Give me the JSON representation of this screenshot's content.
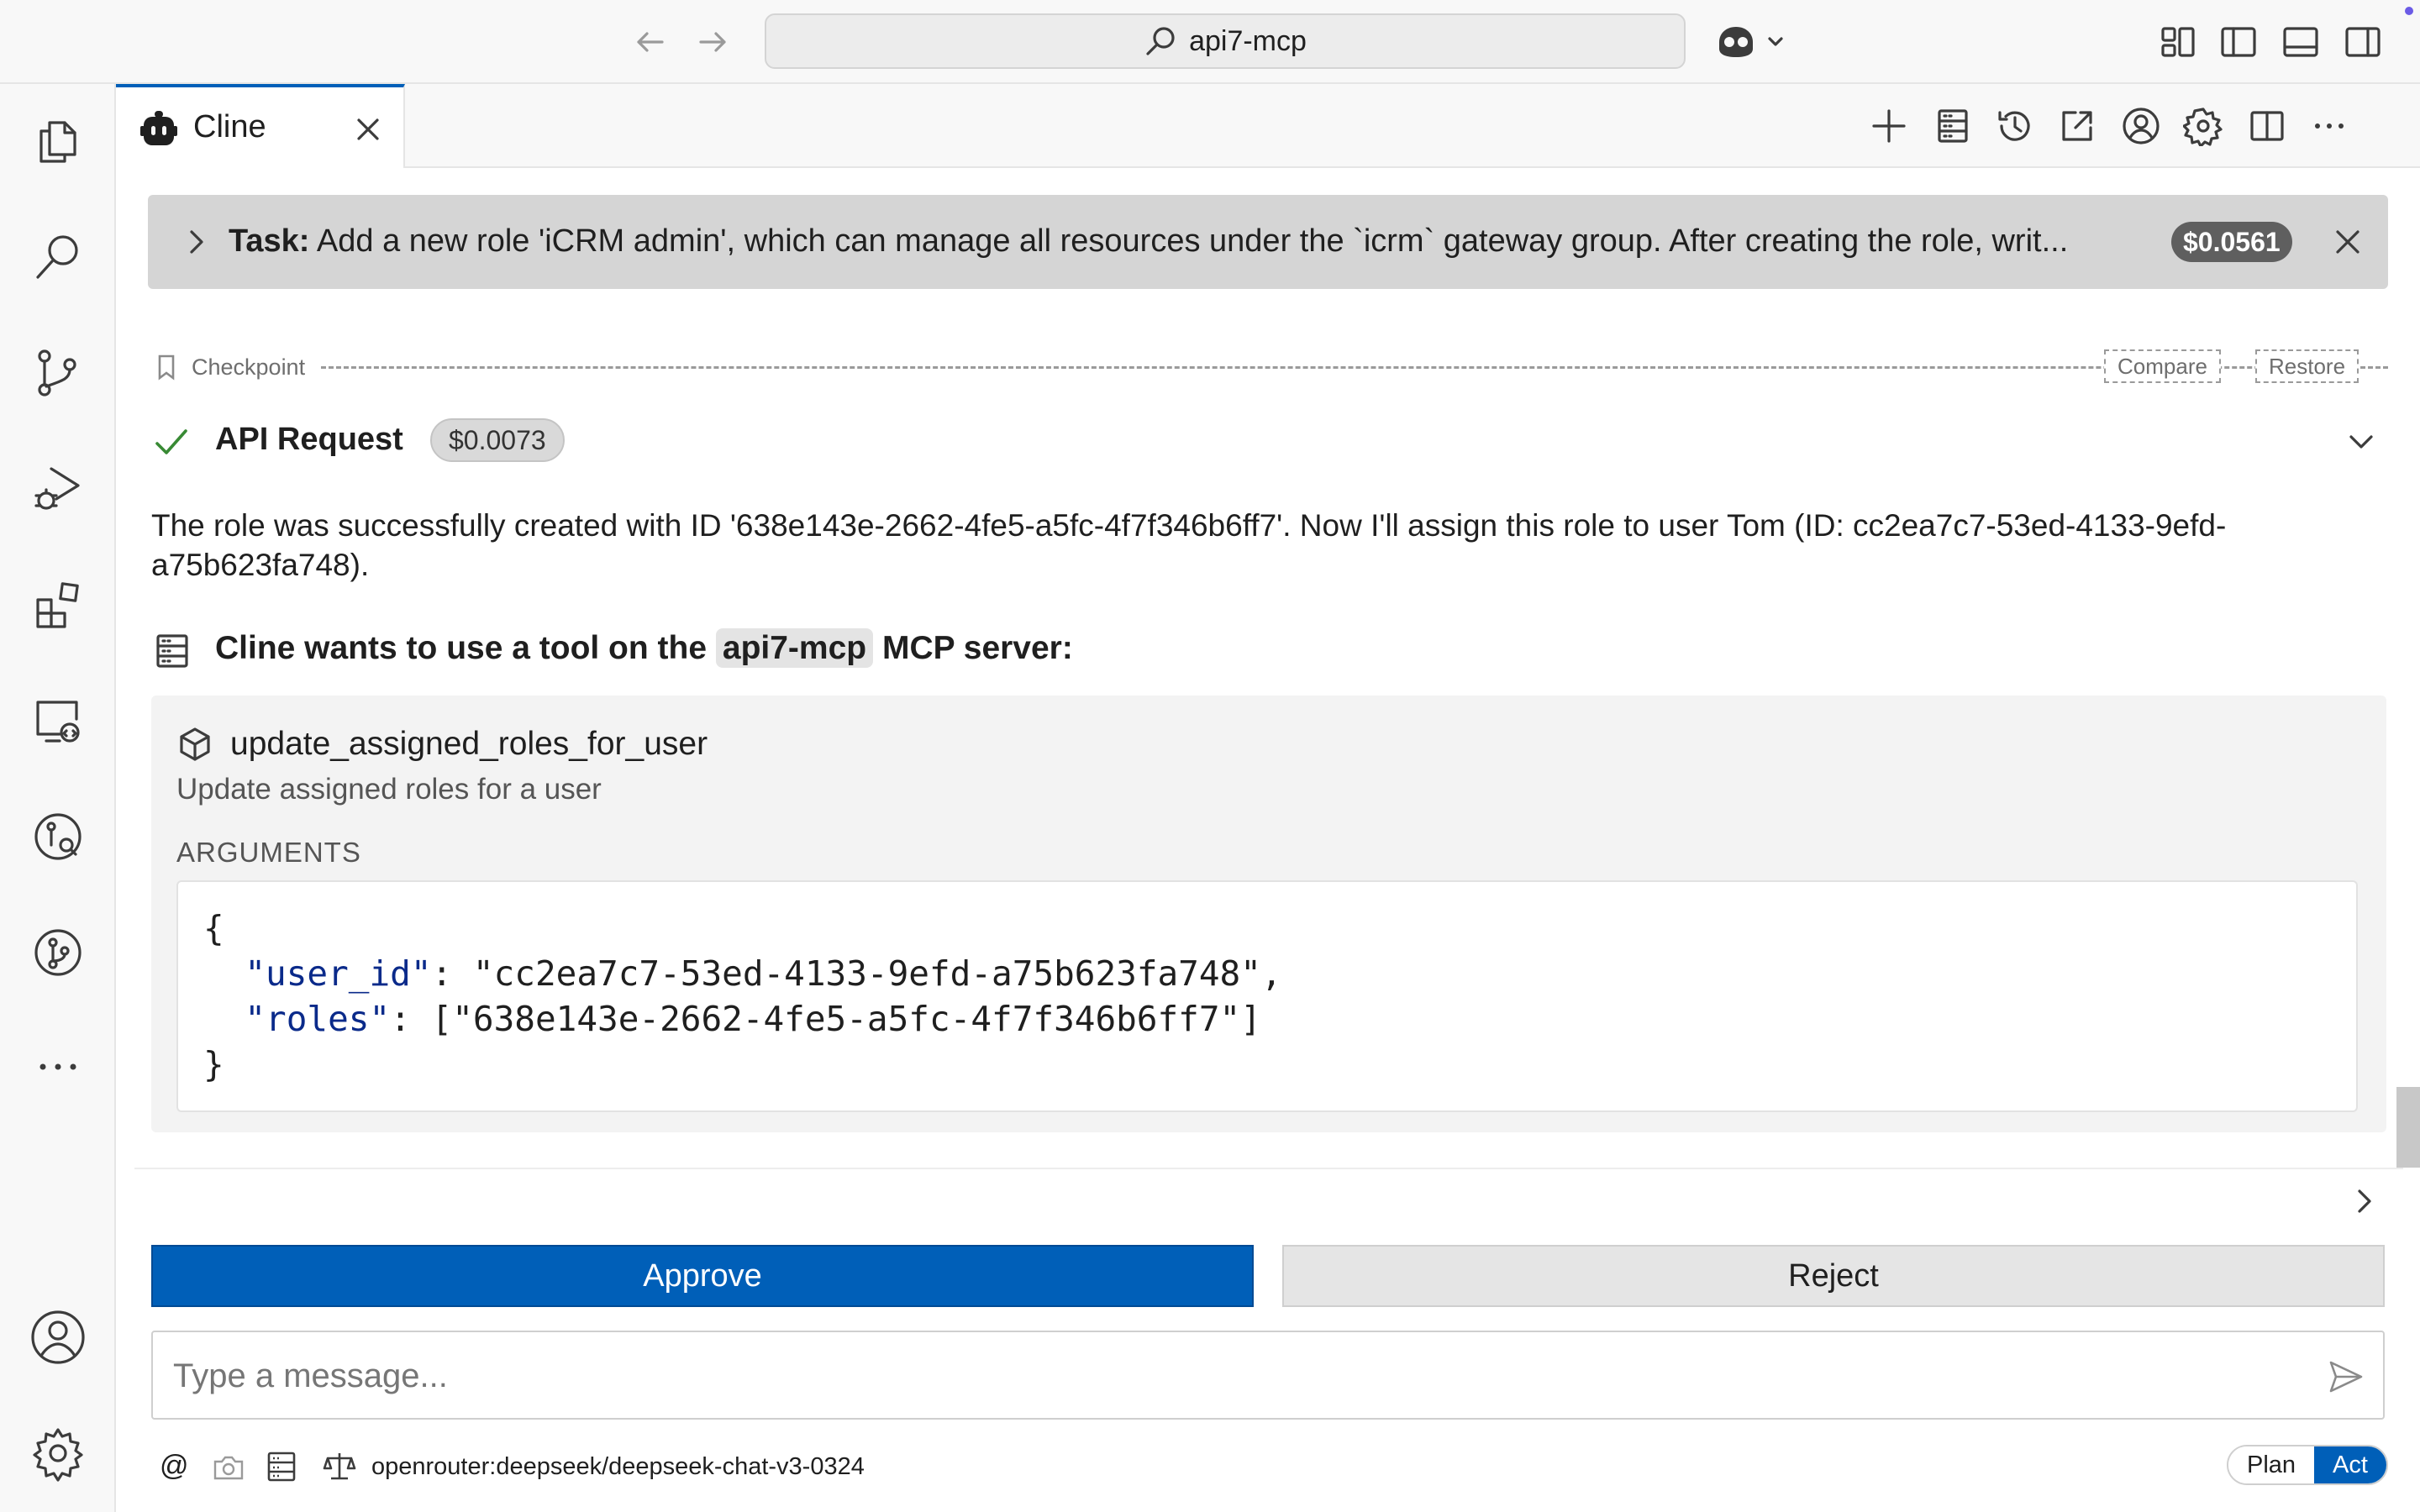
{
  "titlebar": {
    "search_text": "api7-mcp"
  },
  "tab": {
    "label": "Cline"
  },
  "task": {
    "prefix": "Task:",
    "text": "Add a new role 'iCRM admin', which can manage all resources under the `icrm` gateway group. After creating the role, writ...",
    "cost": "$0.0561"
  },
  "checkpoint": {
    "label": "Checkpoint",
    "compare": "Compare",
    "restore": "Restore"
  },
  "api_request": {
    "title": "API Request",
    "cost": "$0.0073"
  },
  "message": "The role was successfully created with ID '638e143e-2662-4fe5-a5fc-4f7f346b6ff7'. Now I'll assign this role to user Tom (ID: cc2ea7c7-53ed-4133-9efd-a75b623fa748).",
  "tool_request": {
    "prefix": "Cline wants to use a tool on the",
    "server": "api7-mcp",
    "suffix": "MCP server:",
    "tool_name": "update_assigned_roles_for_user",
    "tool_desc": "Update assigned roles for a user",
    "args_label": "ARGUMENTS",
    "args": {
      "open": "{",
      "user_id_key": "\"user_id\"",
      "user_id_value": "\"cc2ea7c7-53ed-4133-9efd-a75b623fa748\",",
      "roles_key": "\"roles\"",
      "roles_value": "[\"638e143e-2662-4fe5-a5fc-4f7f346b6ff7\"]",
      "close": "}"
    }
  },
  "actions": {
    "approve": "Approve",
    "reject": "Reject"
  },
  "input": {
    "placeholder": "Type a message..."
  },
  "bottom": {
    "at": "@",
    "model": "openrouter:deepseek/deepseek-chat-v3-0324",
    "plan": "Plan",
    "act": "Act"
  },
  "colors": {
    "accent": "#005fb8",
    "success": "#388a34"
  }
}
